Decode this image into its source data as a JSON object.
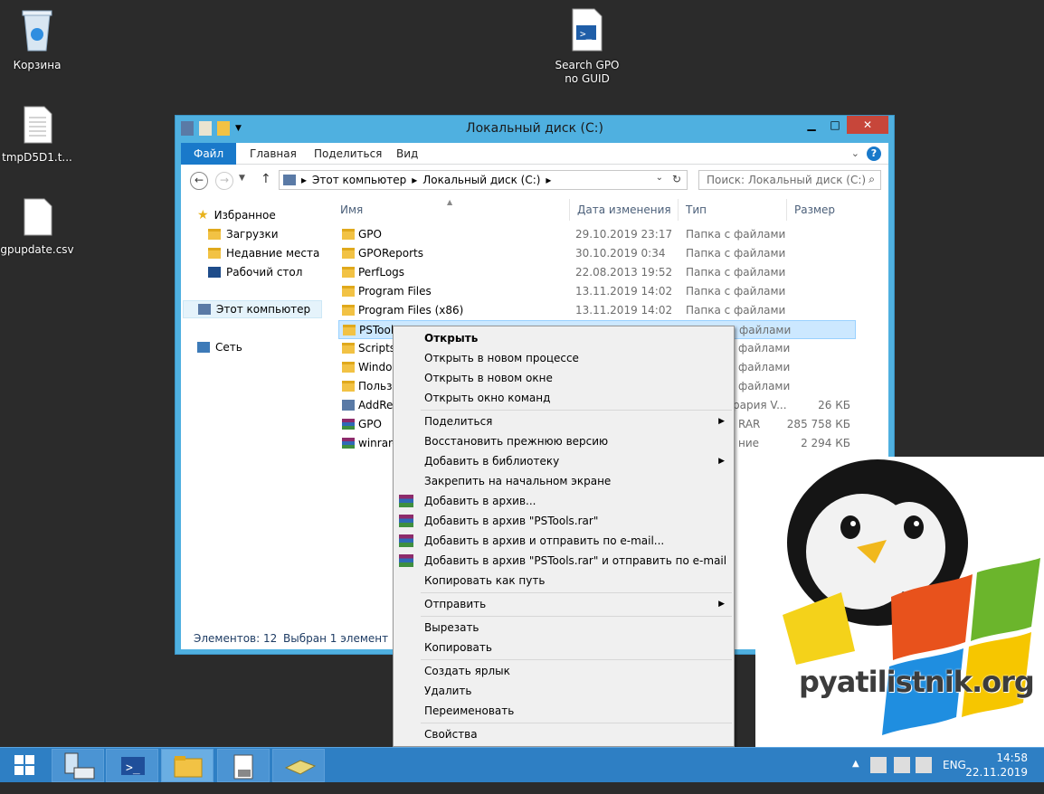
{
  "desktop": {
    "icons": [
      {
        "label": "Корзина",
        "icon": "recycle-bin-icon"
      },
      {
        "label": "tmpD5D1.t...",
        "icon": "text-file-icon"
      },
      {
        "label": "gpupdate.csv",
        "icon": "blank-file-icon"
      },
      {
        "label_line1": "Search GPO",
        "label_line2": "no GUID",
        "icon": "powershell-script-icon"
      }
    ]
  },
  "window": {
    "title": "Локальный диск (C:)",
    "ribbon_tabs": [
      "Файл",
      "Главная",
      "Поделиться",
      "Вид"
    ],
    "address": {
      "crumbs": [
        "Этот компьютер",
        "Локальный диск (C:)"
      ]
    },
    "search": {
      "placeholder": "Поиск: Локальный диск (C:)"
    },
    "nav": {
      "favorites": "Избранное",
      "downloads": "Загрузки",
      "recent": "Недавние места",
      "desktop": "Рабочий стол",
      "computer": "Этот компьютер",
      "network": "Сеть"
    },
    "columns": {
      "name": "Имя",
      "date": "Дата изменения",
      "type": "Тип",
      "size": "Размер"
    },
    "rows": [
      {
        "name": "GPO",
        "date": "29.10.2019 23:17",
        "type": "Папка с файлами",
        "size": "",
        "icon": "folder-icon"
      },
      {
        "name": "GPOReports",
        "date": "30.10.2019 0:34",
        "type": "Папка с файлами",
        "size": "",
        "icon": "folder-icon"
      },
      {
        "name": "PerfLogs",
        "date": "22.08.2013 19:52",
        "type": "Папка с файлами",
        "size": "",
        "icon": "folder-icon"
      },
      {
        "name": "Program Files",
        "date": "13.11.2019 14:02",
        "type": "Папка с файлами",
        "size": "",
        "icon": "folder-icon"
      },
      {
        "name": "Program Files (x86)",
        "date": "13.11.2019 14:02",
        "type": "Папка с файлами",
        "size": "",
        "icon": "folder-icon"
      },
      {
        "name": "PSTools",
        "date": "",
        "type": "файлами",
        "size": "",
        "icon": "folder-icon"
      },
      {
        "name": "Scripts",
        "date": "",
        "type": "файлами",
        "size": "",
        "icon": "folder-icon"
      },
      {
        "name": "Window",
        "date": "",
        "type": "файлами",
        "size": "",
        "icon": "folder-icon"
      },
      {
        "name": "Польз",
        "date": "",
        "type": "файлами",
        "size": "",
        "icon": "folder-icon"
      },
      {
        "name": "AddRe",
        "date": "",
        "type": "рария V...",
        "size": "26 КБ",
        "icon": "application-icon"
      },
      {
        "name": "GPO",
        "date": "",
        "type": "RAR",
        "size": "285 758 КБ",
        "icon": "rar-archive-icon"
      },
      {
        "name": "winrar-",
        "date": "",
        "type": "ние",
        "size": "2 294 КБ",
        "icon": "winrar-installer-icon"
      }
    ],
    "status": {
      "count": "Элементов: 12",
      "selected": "Выбран 1 элемент"
    }
  },
  "context_menu": {
    "open": "Открыть",
    "open_new_process": "Открыть в новом процессе",
    "open_new_window": "Открыть в новом окне",
    "open_cmd": "Открыть окно команд",
    "share": "Поделиться",
    "restore": "Восстановить прежнюю версию",
    "add_library": "Добавить в библиотеку",
    "pin_start": "Закрепить на начальном экране",
    "add_archive": "Добавить в архив...",
    "add_pstools_rar": "Добавить в архив \"PSTools.rar\"",
    "add_email": "Добавить в архив и отправить по e-mail...",
    "add_pstools_email": "Добавить в архив \"PSTools.rar\" и отправить по e-mail",
    "copy_path": "Копировать как путь",
    "send_to": "Отправить",
    "cut": "Вырезать",
    "copy": "Копировать",
    "create_shortcut": "Создать ярлык",
    "delete": "Удалить",
    "rename": "Переименовать",
    "properties": "Свойства"
  },
  "taskbar": {
    "language": "ENG",
    "time": "14:58",
    "date": "22.11.2019"
  },
  "watermark": {
    "text": "pyatilistnik.org"
  }
}
